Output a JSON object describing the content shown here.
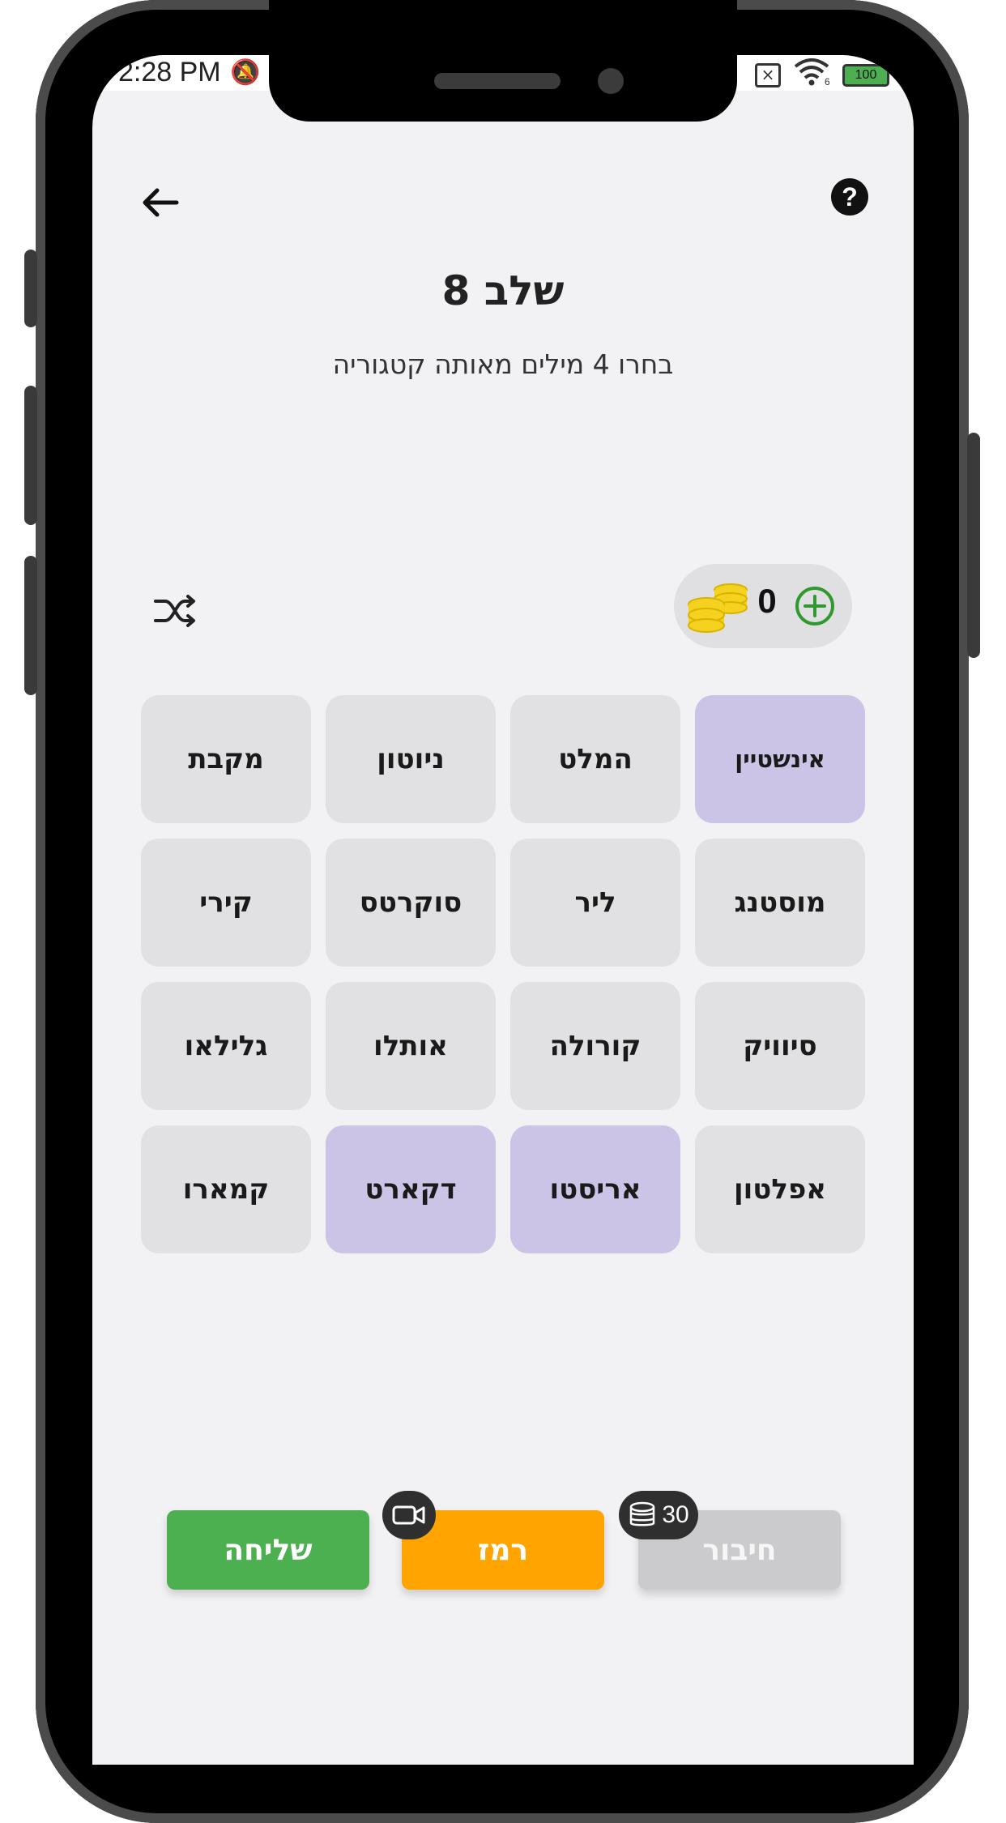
{
  "status_bar": {
    "time": "2:28 PM",
    "battery": "100",
    "wifi_label": "6"
  },
  "header": {
    "title": "שלב 8",
    "subtitle": "בחרו 4 מילים מאותה קטגוריה"
  },
  "coins": {
    "count": "0"
  },
  "tiles": [
    {
      "label": "אינשטיין",
      "selected": true
    },
    {
      "label": "המלט",
      "selected": false
    },
    {
      "label": "ניוטון",
      "selected": false
    },
    {
      "label": "מקבת",
      "selected": false
    },
    {
      "label": "מוסטנג",
      "selected": false
    },
    {
      "label": "ליר",
      "selected": false
    },
    {
      "label": "סוקרטס",
      "selected": false
    },
    {
      "label": "קירי",
      "selected": false
    },
    {
      "label": "סיוויק",
      "selected": false
    },
    {
      "label": "קורולה",
      "selected": false
    },
    {
      "label": "אותלו",
      "selected": false
    },
    {
      "label": "גלילאו",
      "selected": false
    },
    {
      "label": "אפלטון",
      "selected": false
    },
    {
      "label": "אריסטו",
      "selected": true
    },
    {
      "label": "דקארט",
      "selected": true
    },
    {
      "label": "קמארו",
      "selected": false
    }
  ],
  "actions": {
    "send_label": "שליחה",
    "hint_label": "רמז",
    "connect_label": "חיבור",
    "connect_cost": "30"
  },
  "colors": {
    "selected_tile": "#cbc4e6",
    "tile": "#e1e0e3",
    "send": "#4caf50",
    "hint": "#ffa400",
    "disabled": "#cbcacd",
    "add_coins": "#2e9a2e"
  }
}
